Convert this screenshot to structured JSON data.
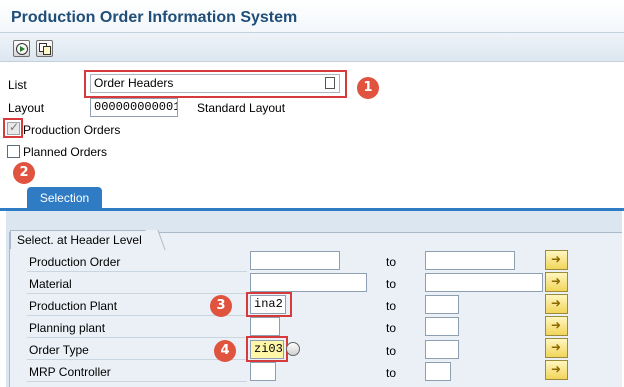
{
  "window": {
    "title": "Production Order Information System"
  },
  "toolbar": {
    "icons": [
      "execute-icon",
      "copy-icon"
    ]
  },
  "list": {
    "label": "List",
    "value": "Order Headers"
  },
  "layout": {
    "label": "Layout",
    "value": "000000000001",
    "description": "Standard Layout"
  },
  "options": {
    "production_orders": {
      "label": "Production Orders",
      "checked": true
    },
    "planned_orders": {
      "label": "Planned Orders",
      "checked": false
    }
  },
  "tab": {
    "label": "Selection"
  },
  "group": {
    "title": "Select. at Header Level"
  },
  "rows": [
    {
      "label": "Production Order",
      "from": "",
      "to_label": "to",
      "to": ""
    },
    {
      "label": "Material",
      "from": "",
      "to_label": "to",
      "to": ""
    },
    {
      "label": "Production Plant",
      "from": "ina2",
      "to_label": "to",
      "to": ""
    },
    {
      "label": "Planning plant",
      "from": "",
      "to_label": "to",
      "to": ""
    },
    {
      "label": "Order Type",
      "from": "zi03",
      "to_label": "to",
      "to": ""
    },
    {
      "label": "MRP Controller",
      "from": "",
      "to_label": "to",
      "to": ""
    }
  ],
  "annotations": [
    "1",
    "2",
    "3",
    "4"
  ],
  "colors": {
    "title": "#1f4e79",
    "tab": "#2f7cc4",
    "callout": "#d63a3a"
  }
}
